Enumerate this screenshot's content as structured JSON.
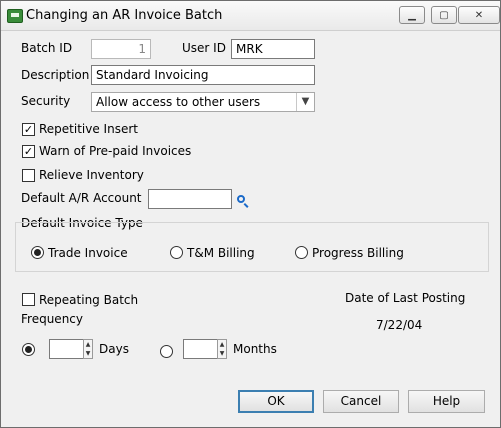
{
  "window": {
    "title": "Changing an AR Invoice Batch"
  },
  "fields": {
    "batch_id_label": "Batch ID",
    "batch_id_value": "1",
    "user_id_label": "User ID",
    "user_id_value": "MRK",
    "description_label": "Description",
    "description_value": "Standard Invoicing",
    "security_label": "Security",
    "security_value": "Allow access to other users",
    "default_ar_label": "Default A/R Account",
    "default_ar_value": ""
  },
  "checkboxes": {
    "repetitive_insert": {
      "label": "Repetitive Insert",
      "checked": true
    },
    "warn_prepaid": {
      "label": "Warn of Pre-paid Invoices",
      "checked": true
    },
    "relieve_inventory": {
      "label": "Relieve Inventory",
      "checked": false
    },
    "repeating_batch": {
      "label": "Repeating Batch",
      "checked": false
    }
  },
  "invoice_type": {
    "label": "Default Invoice Type",
    "options": [
      "Trade Invoice",
      "T&M Billing",
      "Progress Billing"
    ],
    "selected": "Trade Invoice"
  },
  "frequency": {
    "label": "Frequency",
    "days_label": "Days",
    "months_label": "Months",
    "days_value": "",
    "months_value": ""
  },
  "last_posting": {
    "label": "Date of Last Posting",
    "value": "7/22/04"
  },
  "buttons": {
    "ok": "OK",
    "cancel": "Cancel",
    "help": "Help"
  }
}
